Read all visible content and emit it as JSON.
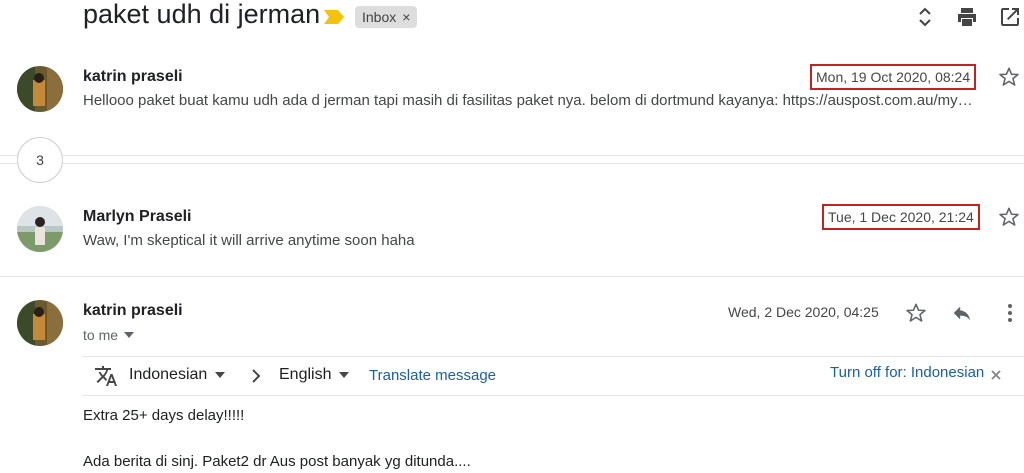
{
  "thread": {
    "subject": "paket udh di jerman",
    "label": "Inbox",
    "label_remove_glyph": "×"
  },
  "messages": [
    {
      "sender": "katrin praseli",
      "date": "Mon, 19 Oct 2020, 08:24",
      "snippet": "Hellooo paket buat kamu udh ada d jerman tapi masih di fasilitas paket nya. belom di dortmund kayanya: https://auspost.com.au/my…"
    },
    {
      "sender": "Marlyn Praseli",
      "date": "Tue, 1 Dec 2020, 21:24",
      "snippet": "Waw, I'm skeptical it will arrive anytime soon haha"
    },
    {
      "sender": "katrin praseli",
      "date": "Wed, 2 Dec 2020, 04:25",
      "to_label": "to me"
    }
  ],
  "collapsed_count": "3",
  "translate": {
    "from_lang": "Indonesian",
    "to_lang": "English",
    "translate_link": "Translate message",
    "turn_off": "Turn off for: Indonesian"
  },
  "body_lines": [
    "Extra 25+ days delay!!!!!",
    "Ada berita di sinj. Paket2 dr Aus post banyak yg ditunda...."
  ],
  "colors": {
    "accent_link": "#1a5fa8",
    "highlight_box": "#c5221f",
    "importance_marker": "#f4c20d"
  },
  "icons": {
    "importance": "label-important-icon",
    "expand": "unfold-icon",
    "print": "print-icon",
    "popout": "open-in-new-icon",
    "star": "star-outline-icon",
    "reply": "reply-icon",
    "more": "more-vert-icon",
    "translate": "translate-icon"
  }
}
